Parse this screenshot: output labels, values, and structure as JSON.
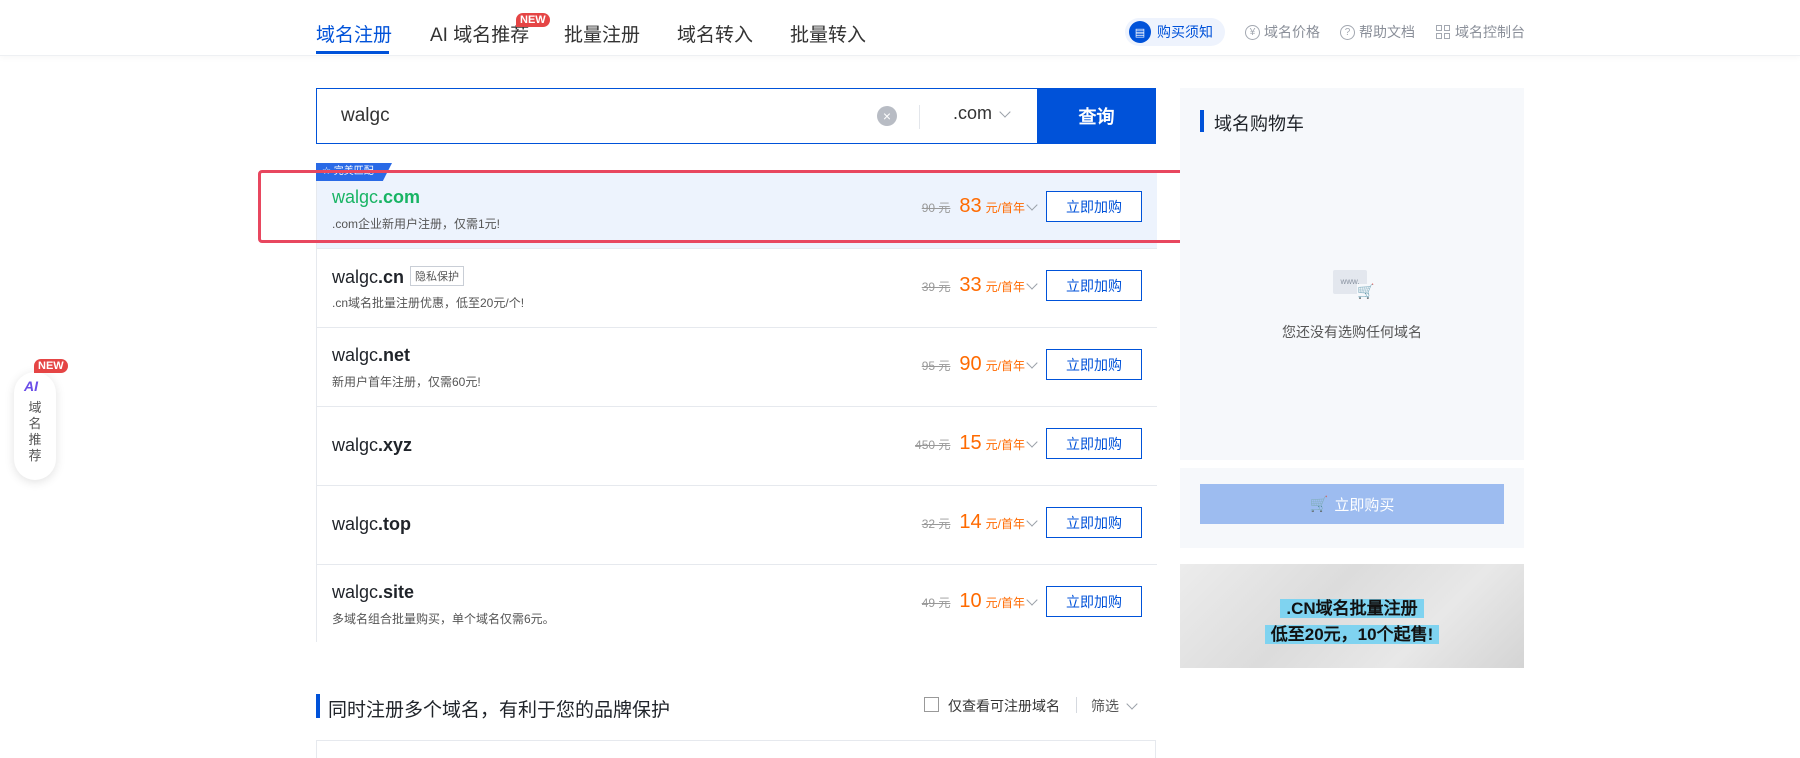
{
  "nav": {
    "tabs": [
      {
        "label": "域名注册",
        "active": true
      },
      {
        "label": "AI 域名推荐"
      },
      {
        "label": "批量注册"
      },
      {
        "label": "域名转入"
      },
      {
        "label": "批量转入"
      }
    ],
    "new_badge": "NEW",
    "tools": {
      "purchase_notice": "购买须知",
      "price": "域名价格",
      "help": "帮助文档",
      "console": "域名控制台"
    }
  },
  "search": {
    "value": "walgc",
    "suffix": ".com",
    "button": "查询"
  },
  "results": {
    "match_tag": "完美匹配",
    "buy_label": "立即加购",
    "privacy_tag": "隐私保护",
    "unit": "元/首年",
    "rows": [
      {
        "name": "walgc",
        "tld": ".com",
        "desc": ".com企业新用户注册，仅需1元!",
        "old_price": "90 元",
        "price": "83"
      },
      {
        "name": "walgc",
        "tld": ".cn",
        "desc": ".cn域名批量注册优惠，低至20元/个!",
        "old_price": "39 元",
        "price": "33"
      },
      {
        "name": "walgc",
        "tld": ".net",
        "desc": "新用户首年注册，仅需60元!",
        "old_price": "95 元",
        "price": "90"
      },
      {
        "name": "walgc",
        "tld": ".xyz",
        "desc": "",
        "old_price": "450 元",
        "price": "15"
      },
      {
        "name": "walgc",
        "tld": ".top",
        "desc": "",
        "old_price": "32 元",
        "price": "14"
      },
      {
        "name": "walgc",
        "tld": ".site",
        "desc": "多域名组合批量购买，单个域名仅需6元。",
        "old_price": "49 元",
        "price": "10"
      }
    ]
  },
  "section": {
    "title": "同时注册多个域名，有利于您的品牌保护",
    "only_available": "仅查看可注册域名",
    "filter": "筛选"
  },
  "cart": {
    "title": "域名购物车",
    "empty_icon_text": "www.",
    "empty": "您还没有选购任何域名",
    "buy": "立即购买"
  },
  "banner": {
    "line1": ".CN域名批量注册",
    "line2": "低至20元，10个起售!"
  },
  "ai_widget": {
    "logo": "AI",
    "label": "域名推荐",
    "badge": "NEW"
  },
  "colors": {
    "primary": "#0052d9",
    "price": "#ff6a00",
    "match_green": "#18b464",
    "highlight": "#e8475f"
  }
}
